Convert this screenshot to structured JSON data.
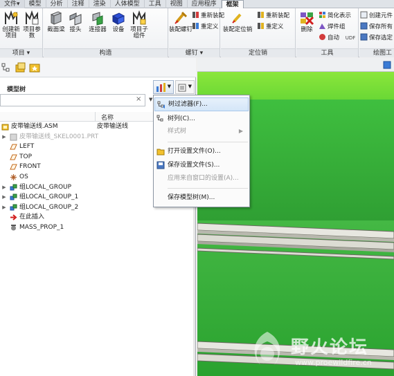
{
  "ribbon_tabs": [
    "文件▾",
    "模型",
    "分析",
    "注释",
    "渲染",
    "人体模型",
    "工具",
    "视图",
    "应用程序",
    "框架"
  ],
  "groups": {
    "xiangmu": {
      "title": "项目 ▾",
      "buttons": [
        "创建新项目",
        "项目参数"
      ]
    },
    "gouzao": {
      "title": "构造",
      "buttons": [
        "截面梁",
        "接头",
        "连接器",
        "设备",
        "项目子组件"
      ]
    },
    "luoding": {
      "title": "螺钉 ▾",
      "big": "装配螺钉",
      "small": [
        "重新装配",
        "重定义"
      ]
    },
    "dingweixiao": {
      "title": "定位销",
      "big": "装配定位销",
      "small": [
        "重新装配",
        "重定义"
      ]
    },
    "gongju": {
      "title": "工具",
      "big": "删除",
      "small": [
        "简化表示",
        "焊件组",
        "自动",
        "UDF"
      ]
    },
    "huitu": {
      "title": "绘图工",
      "small": [
        "创建元件",
        "保存所有",
        "保存选定"
      ]
    }
  },
  "tree": {
    "title": "模型树",
    "column_name": "名称",
    "rows": [
      {
        "label": "皮带输送线.ASM",
        "value": "皮带输送线",
        "icon": "assembly-icon",
        "expand": "",
        "muted": false
      },
      {
        "label": "皮带输送线_SKEL0001.PRT",
        "value": "",
        "icon": "skeleton-part-icon",
        "expand": "▶",
        "muted": true
      },
      {
        "label": "LEFT",
        "value": "",
        "icon": "datum-plane-icon",
        "expand": "",
        "muted": false
      },
      {
        "label": "TOP",
        "value": "",
        "icon": "datum-plane-icon",
        "expand": "",
        "muted": false
      },
      {
        "label": "FRONT",
        "value": "",
        "icon": "datum-plane-icon",
        "expand": "",
        "muted": false
      },
      {
        "label": "OS",
        "value": "",
        "icon": "coordinate-system-icon",
        "expand": "",
        "muted": false
      },
      {
        "label": "组LOCAL_GROUP",
        "value": "",
        "icon": "group-icon",
        "expand": "▶",
        "muted": false
      },
      {
        "label": "组LOCAL_GROUP_1",
        "value": "",
        "icon": "group-icon",
        "expand": "▶",
        "muted": false
      },
      {
        "label": "组LOCAL_GROUP_2",
        "value": "",
        "icon": "group-icon",
        "expand": "▶",
        "muted": false
      },
      {
        "label": "在此插入",
        "value": "",
        "icon": "insert-here-icon",
        "expand": "",
        "muted": false
      },
      {
        "label": "MASS_PROP_1",
        "value": "",
        "icon": "mass-prop-icon",
        "expand": "",
        "muted": false
      }
    ]
  },
  "menu": {
    "items": [
      {
        "label": "树过滤器(F)...",
        "icon": "tree-filter-icon",
        "highlighted": true,
        "disabled": false
      },
      {
        "label": "树列(C)...",
        "icon": "tree-columns-icon",
        "highlighted": false,
        "disabled": false
      },
      {
        "label": "样式树",
        "icon": "",
        "highlighted": false,
        "disabled": true,
        "submenu": "▶"
      },
      {
        "label": "打开设置文件(O)...",
        "icon": "open-folder-icon",
        "highlighted": false,
        "disabled": false
      },
      {
        "label": "保存设置文件(S)...",
        "icon": "save-icon",
        "highlighted": false,
        "disabled": false
      },
      {
        "label": "应用来自窗口的设置(A)...",
        "icon": "",
        "highlighted": false,
        "disabled": true
      },
      {
        "label": "保存模型树(M)...",
        "icon": "",
        "highlighted": false,
        "disabled": false
      }
    ]
  },
  "watermark": {
    "title": "野火论坛",
    "url": "www.proewildfire.cn"
  },
  "colors": {
    "accent_blue": "#2a6fc9",
    "menu_highlight": "#d4e6f8",
    "graphics_green": "#2f9a2f"
  }
}
